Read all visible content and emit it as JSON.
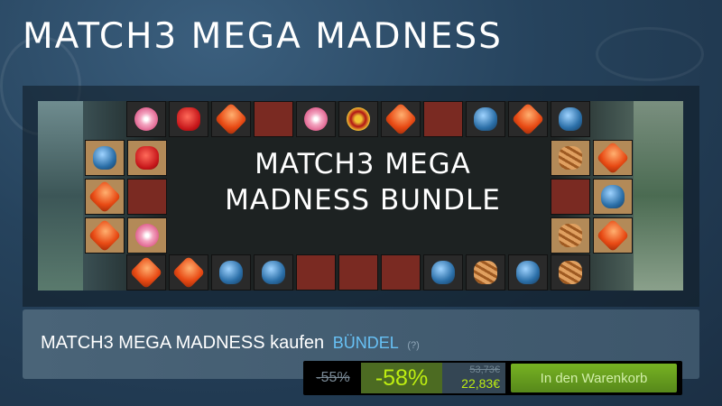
{
  "page": {
    "title": "MATCH3 MEGA MADNESS"
  },
  "banner": {
    "line1": "MATCH3 MEGA",
    "line2": "MADNESS BUNDLE"
  },
  "purchase": {
    "title": "MATCH3 MEGA MADNESS kaufen",
    "type_label": "BÜNDEL",
    "help": "(?)",
    "old_discount": "-55%",
    "discount": "-58%",
    "original_price": "53,73€",
    "final_price": "22,83€",
    "cart_button": "In den Warenkorb"
  },
  "colors": {
    "accent_blue": "#67c1f5",
    "discount_green": "#beee11",
    "cart_green": "#75b022"
  }
}
